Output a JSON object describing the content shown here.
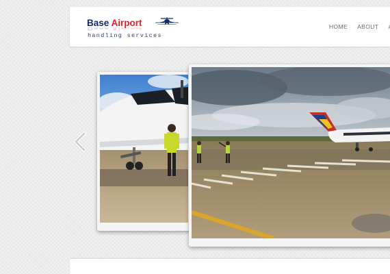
{
  "logo": {
    "word1": "Base",
    "word2": "Airport",
    "tagline": "handling services",
    "icon": "airplane-icon",
    "colors": {
      "base": "#0e2a6b",
      "airport": "#e3202b"
    }
  },
  "nav": {
    "items": [
      {
        "label": "HOME"
      },
      {
        "label": "ABOUT"
      },
      {
        "label": "A"
      }
    ]
  },
  "slider": {
    "prev_icon": "chevron-left-icon",
    "slides": [
      {
        "name": "jet-nose-ground-crew"
      },
      {
        "name": "tarmac-jet-marshallers"
      }
    ]
  }
}
